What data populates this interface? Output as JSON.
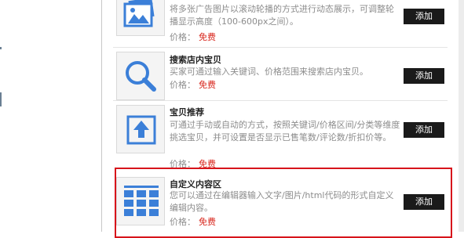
{
  "items": [
    {
      "icon": "image-carousel-icon",
      "title": "",
      "description": "将多张广告图片以滚动轮播的方式进行动态展示，可调整轮播显示高度（100-600px之间）。",
      "price_label": "价格：",
      "price_value": "免费",
      "button_label": "添加"
    },
    {
      "icon": "magnifier-icon",
      "title": "搜索店内宝贝",
      "description": "买家可通过输入关键词、价格范围来搜索店内宝贝。",
      "price_label": "价格：",
      "price_value": "免费",
      "button_label": "添加"
    },
    {
      "icon": "upload-arrow-icon",
      "title": "宝贝推荐",
      "description": "可通过手动或自动的方式，按照关键词/价格区间/分类等维度挑选宝贝，并可设置是否显示已售笔数/评论数/折扣价等。",
      "price_label": "价格：",
      "price_value": "免费",
      "button_label": "添加"
    },
    {
      "icon": "grid-content-icon",
      "title": "自定义内容区",
      "description": "您可以通过在编辑器输入文字/图片/html代码的形式自定义编辑内容。",
      "price_label": "价格：",
      "price_value": "免费",
      "button_label": "添加"
    }
  ],
  "colors": {
    "icon_blue": "#3b7fd8",
    "price_free": "#d8261c",
    "highlight_border": "#d7141b",
    "button_bg": "#1a1a1a"
  }
}
